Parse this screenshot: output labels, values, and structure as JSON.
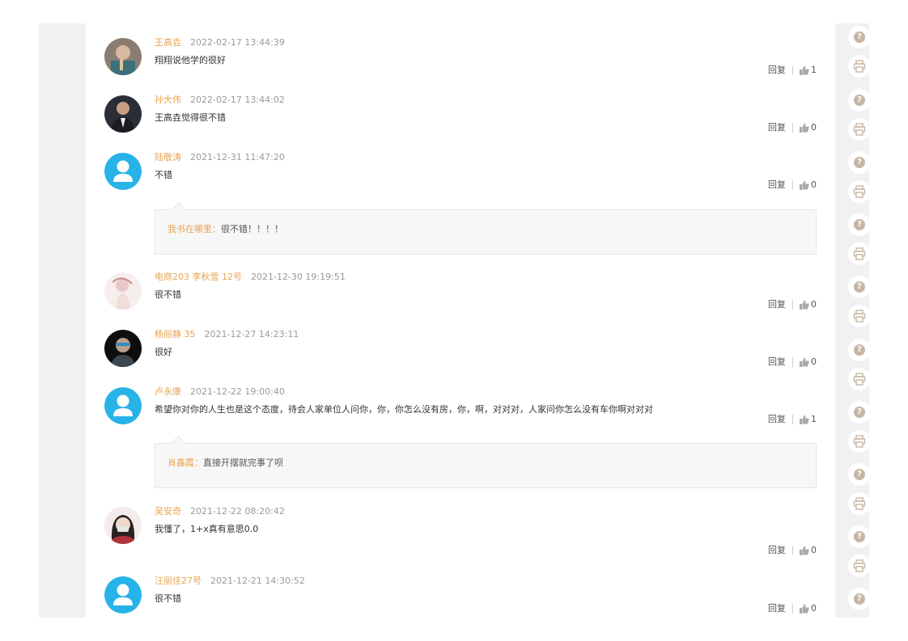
{
  "comments": [
    {
      "author": "王高垚",
      "time": "2022-02-17 13:44:39",
      "text": "翔翔说他学的很好",
      "reply_label": "回复",
      "likes": "1",
      "avatar": "photo-avatar"
    },
    {
      "author": "孙大伟",
      "time": "2022-02-17 13:44:02",
      "text": "王高垚觉得很不错",
      "reply_label": "回复",
      "likes": "0",
      "avatar": "photo-avatar"
    },
    {
      "author": "陆敬涛",
      "time": "2021-12-31 11:47:20",
      "text": "不错",
      "reply_label": "回复",
      "likes": "0",
      "avatar": "default-avatar",
      "sub": {
        "author": "我书在哪里：",
        "text": "很不错！！！！"
      }
    },
    {
      "author": "电商203 李秋雪 12号",
      "time": "2021-12-30 19:19:51",
      "text": "很不错",
      "reply_label": "回复",
      "likes": "0",
      "avatar": "photo-avatar"
    },
    {
      "author": "杨丽静 35",
      "time": "2021-12-27 14:23:11",
      "text": "很好",
      "reply_label": "回复",
      "likes": "0",
      "avatar": "photo-avatar"
    },
    {
      "author": "卢永康",
      "time": "2021-12-22 19:00:40",
      "text": "希望你对你的人生也是这个态度，待会人家单位人问你，你，你怎么没有房，你，啊，对对对，人家问你怎么没有车你啊对对对",
      "reply_label": "回复",
      "likes": "1",
      "avatar": "default-avatar",
      "sub": {
        "author": "肖鑫霞：",
        "text": "直接开摆就完事了呗"
      }
    },
    {
      "author": "吴安奇",
      "time": "2021-12-22 08:20:42",
      "text": "我懂了，1+x真有意思0.0",
      "reply_label": "回复",
      "likes": "0",
      "avatar": "photo-avatar"
    },
    {
      "author": "汪丽佳27号",
      "time": "2021-12-21 14:30:52",
      "text": "很不错",
      "reply_label": "回复",
      "likes": "0",
      "avatar": "default-avatar"
    }
  ],
  "side_rail": {
    "icons": [
      "help-icon",
      "print-icon",
      "help-icon",
      "print-icon",
      "help-icon",
      "print-icon",
      "help-icon",
      "print-icon",
      "help-icon",
      "print-icon",
      "help-icon",
      "print-icon",
      "help-icon",
      "print-icon",
      "help-icon",
      "print-icon",
      "help-icon",
      "print-icon",
      "help-icon",
      "print-icon"
    ],
    "help_glyph": "?"
  },
  "colors": {
    "author": "#e8a451",
    "time": "#9a9a9a",
    "default_avatar": "#27b3e8",
    "rail_glyph": "#c7b6a4"
  }
}
